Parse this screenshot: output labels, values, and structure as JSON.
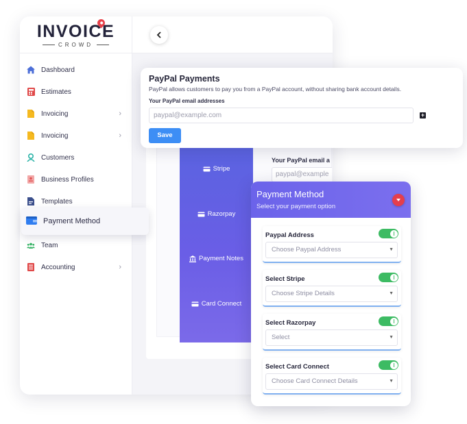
{
  "brand": {
    "name_main": "INVOICE",
    "name_sub": "CROWD",
    "accent": "#e8414a"
  },
  "topbar": {
    "back_icon": "chevron-left-icon"
  },
  "sidebar": {
    "items": [
      {
        "label": "Dashboard",
        "icon": "home-icon",
        "has_chevron": false
      },
      {
        "label": "Estimates",
        "icon": "calculator-icon",
        "has_chevron": false
      },
      {
        "label": "Invoicing",
        "icon": "document-icon",
        "has_chevron": true
      },
      {
        "label": "Invoicing",
        "icon": "document-icon",
        "has_chevron": true
      },
      {
        "label": "Customers",
        "icon": "customer-icon",
        "has_chevron": false
      },
      {
        "label": "Business Profiles",
        "icon": "profile-icon",
        "has_chevron": false
      },
      {
        "label": "Templates",
        "icon": "template-icon",
        "has_chevron": false
      },
      {
        "label": "Payment Method",
        "icon": "wallet-icon",
        "has_chevron": false,
        "active": true
      },
      {
        "label": "Team",
        "icon": "team-icon",
        "has_chevron": false
      },
      {
        "label": "Accounting",
        "icon": "accounting-icon",
        "has_chevron": true
      }
    ],
    "chevron": "›"
  },
  "gateways": {
    "items": [
      {
        "label": "Stripe",
        "icon": "card-icon"
      },
      {
        "label": "Razorpay",
        "icon": "card-icon"
      },
      {
        "label": "Payment Notes",
        "icon": "bank-icon"
      },
      {
        "label": "Card Connect",
        "icon": "card-icon"
      }
    ],
    "bg_label": "Your PayPal email a",
    "bg_input": "paypal@example"
  },
  "paypal": {
    "title": "PayPal Payments",
    "description": "PayPal allows customers to pay you from a PayPal account, without sharing bank account details.",
    "field_label": "Your PayPal email addresses",
    "placeholder": "paypal@example.com",
    "add_label": "+",
    "save_label": "Save",
    "button_color": "#3d8ef5"
  },
  "payment_method": {
    "title": "Payment Method",
    "subtitle": "Select your payment option",
    "header_color": "#6b63ea",
    "sections": [
      {
        "label": "Paypal Address",
        "placeholder": "Choose Paypal Address",
        "enabled": true
      },
      {
        "label": "Select Stripe",
        "placeholder": "Choose Stripe Details",
        "enabled": true
      },
      {
        "label": "Select Razorpay",
        "placeholder": "Select",
        "enabled": true
      },
      {
        "label": "Select Card Connect",
        "placeholder": "Choose Card Connect Details",
        "enabled": true
      }
    ],
    "caret": "▼",
    "switch_color": "#3dbb63"
  }
}
